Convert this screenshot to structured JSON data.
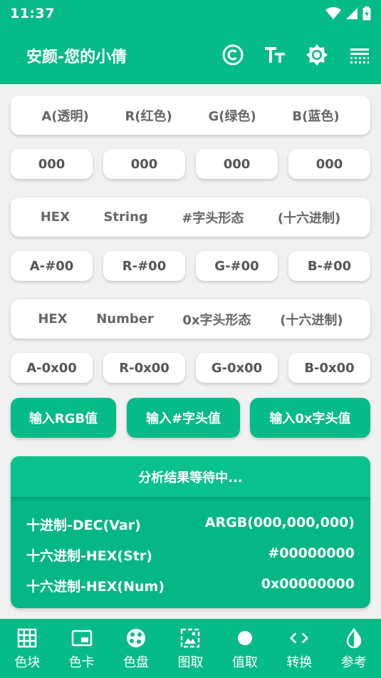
{
  "status_bar": {
    "time": "11:37"
  },
  "app_bar": {
    "title": "安颜-您的小倩",
    "actions": [
      "copyright-icon",
      "text-size-icon",
      "brightness-icon",
      "menu-lines-icon"
    ]
  },
  "colors": {
    "primary": "#05bb86",
    "background": "#f1f1f1",
    "card": "#ffffff"
  },
  "decimal_header": [
    "A(透明)",
    "R(红色)",
    "G(绿色)",
    "B(蓝色)"
  ],
  "decimal_values": [
    "000",
    "000",
    "000",
    "000"
  ],
  "hex_string_header": [
    "HEX",
    "String",
    "#字头形态",
    "(十六进制)"
  ],
  "hex_string_values": [
    "A-#00",
    "R-#00",
    "G-#00",
    "B-#00"
  ],
  "hex_number_header": [
    "HEX",
    "Number",
    "0x字头形态",
    "(十六进制)"
  ],
  "hex_number_values": [
    "A-0x00",
    "R-0x00",
    "G-0x00",
    "B-0x00"
  ],
  "buttons": {
    "rgb": "输入RGB值",
    "hash": "输入#字头值",
    "ox": "输入0x字头值"
  },
  "result": {
    "title": "分析结果等待中...",
    "rows": [
      {
        "label": "十进制-DEC(Var)",
        "value": "ARGB(000,000,000)"
      },
      {
        "label": "十六进制-HEX(Str)",
        "value": "#00000000"
      },
      {
        "label": "十六进制-HEX(Num)",
        "value": "0x00000000"
      }
    ]
  },
  "bottom_nav": [
    {
      "label": "色块",
      "icon": "grid-icon"
    },
    {
      "label": "色卡",
      "icon": "card-icon"
    },
    {
      "label": "色盘",
      "icon": "palette-icon"
    },
    {
      "label": "图取",
      "icon": "image-picker-icon"
    },
    {
      "label": "值取",
      "icon": "dot-icon"
    },
    {
      "label": "转换",
      "icon": "code-arrows-icon"
    },
    {
      "label": "参考",
      "icon": "contrast-icon"
    }
  ]
}
